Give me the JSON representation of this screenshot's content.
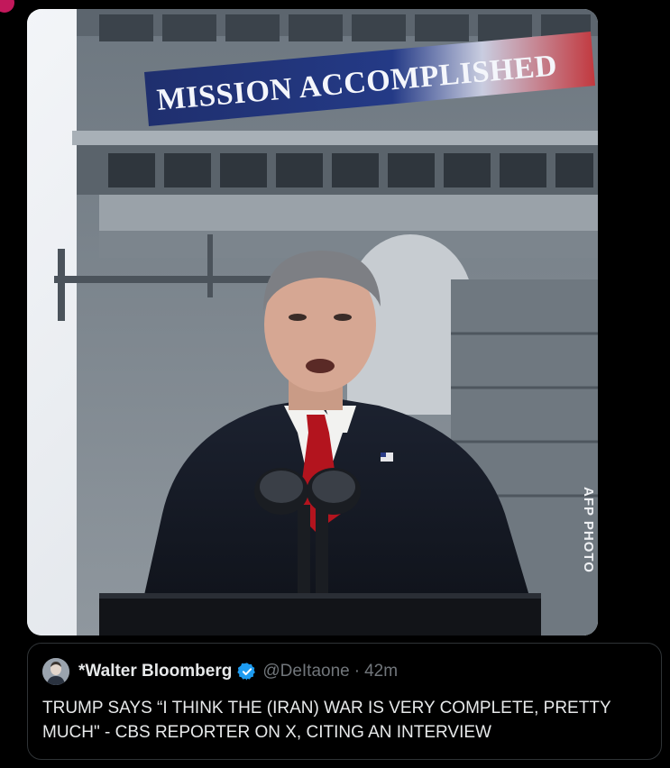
{
  "media": {
    "banner_text": "MISSION ACCOMPLISHED",
    "photo_credit": "AFP PHOTO"
  },
  "quoted_post": {
    "display_name": "*Walter Bloomberg",
    "handle": "@DeItaone",
    "separator": "·",
    "time": "42m",
    "text": "TRUMP SAYS  “I THINK THE (IRAN) WAR IS VERY COMPLETE, PRETTY MUCH\" - CBS REPORTER ON X, CITING AN INTERVIEW",
    "verified_icon": "verified-badge-icon"
  },
  "colors": {
    "background": "#000000",
    "text": "#e7e9ea",
    "muted": "#71767b",
    "border": "#2f3336",
    "verified": "#1d9bf0"
  }
}
